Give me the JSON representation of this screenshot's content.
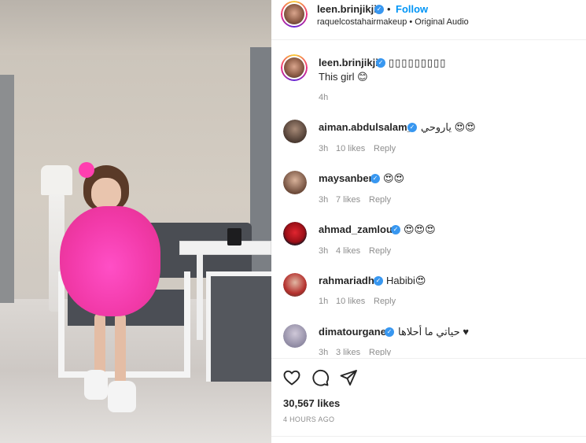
{
  "post": {
    "author": "leen.brinjikji",
    "follow_label": "Follow",
    "dot": "•",
    "audio_credit": "raquelcostahairmakeup • Original Audio",
    "caption_head": "▯▯▯▯▯▯▯▯▯",
    "caption_text": "This girl 😊",
    "caption_time": "4h",
    "likes_label": "30,567 likes",
    "posted_label": "4 HOURS AGO"
  },
  "comments": [
    {
      "user": "aiman.abdulsalam_",
      "text": "ياروحي 😍😍",
      "time": "3h",
      "likes": "10 likes",
      "reply": "Reply",
      "avatar_color": "#6b5a4e"
    },
    {
      "user": "maysanber",
      "text": "😍😍",
      "time": "3h",
      "likes": "7 likes",
      "reply": "Reply",
      "avatar_color": "#8a6a56"
    },
    {
      "user": "ahmad_zamlout",
      "text": "😍😍😍",
      "time": "3h",
      "likes": "4 likes",
      "reply": "Reply",
      "avatar_color": "#b3191f"
    },
    {
      "user": "rahmariadh",
      "text": "Habibi😍",
      "time": "1h",
      "likes": "10 likes",
      "reply": "Reply",
      "avatar_color": "#8e5548"
    },
    {
      "user": "dimatourgane",
      "text": "حياتي ما أحلاها ♥",
      "time": "3h",
      "likes": "3 likes",
      "reply": "Reply",
      "avatar_color": "#8f8aa3"
    }
  ],
  "icons": {
    "like": "heart-icon",
    "comment": "comment-bubble-icon",
    "share": "paper-plane-icon",
    "verified": "verified-badge-icon"
  },
  "colors": {
    "accent": "#0095f6",
    "verified": "#3897f0"
  }
}
